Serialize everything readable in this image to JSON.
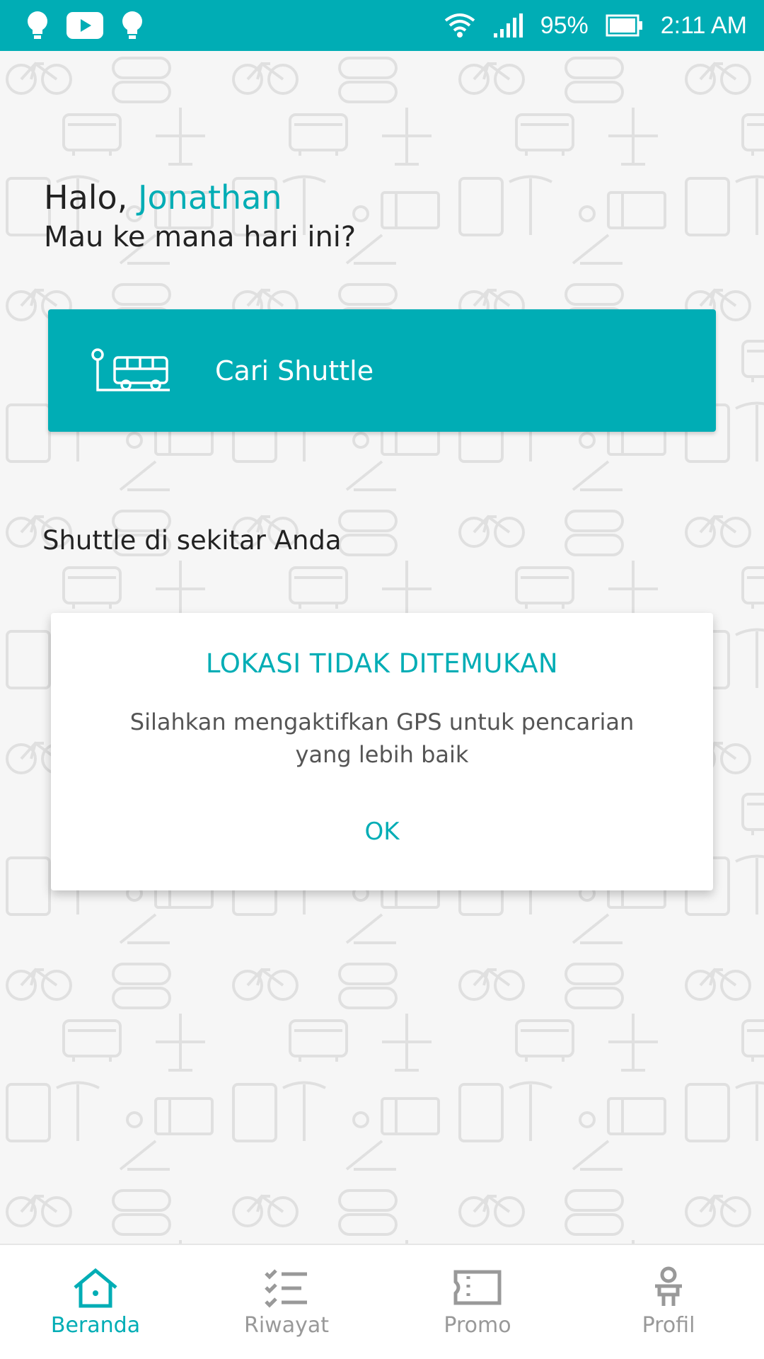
{
  "status_bar": {
    "battery": "95%",
    "time": "2:11 AM",
    "left_icons": [
      "lightbulb-icon",
      "youtube-icon",
      "lightbulb-icon"
    ],
    "right_icons": [
      "wifi-icon",
      "signal-icon",
      "battery-icon"
    ]
  },
  "greeting": {
    "hello": "Halo, ",
    "name": "Jonathan",
    "question": "Mau ke mana hari ini?"
  },
  "search": {
    "label": "Cari Shuttle",
    "icon": "shuttle-bus-icon"
  },
  "nearby": {
    "title": "Shuttle di sekitar Anda"
  },
  "dialog": {
    "title": "LOKASI TIDAK DITEMUKAN",
    "message": "Silahkan mengaktifkan GPS untuk pencarian yang lebih baik",
    "ok_label": "OK"
  },
  "nav": {
    "items": [
      {
        "label": "Beranda",
        "icon": "home-icon",
        "active": true
      },
      {
        "label": "Riwayat",
        "icon": "history-list-icon",
        "active": false
      },
      {
        "label": "Promo",
        "icon": "ticket-icon",
        "active": false
      },
      {
        "label": "Profil",
        "icon": "profile-icon",
        "active": false
      }
    ]
  },
  "colors": {
    "accent": "#00adb5",
    "background": "#f6f6f6",
    "pattern": "#e0e0e0",
    "inactive_nav": "#999999"
  }
}
